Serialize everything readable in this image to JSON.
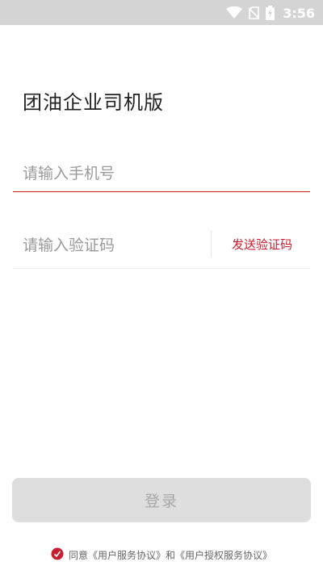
{
  "status_bar": {
    "time": "3:56",
    "icons": [
      "wifi-icon",
      "no-sim-icon",
      "battery-charging-icon"
    ]
  },
  "app": {
    "title": "团油企业司机版"
  },
  "form": {
    "phone_placeholder": "请输入手机号",
    "code_placeholder": "请输入验证码",
    "send_code_label": "发送验证码",
    "login_label": "登录"
  },
  "agreement": {
    "text": "同意《用户服务协议》和《用户授权服务协议》",
    "icon": "checkbox-circle-icon"
  },
  "colors": {
    "accent": "#c81e2f",
    "status_bar": "#d4d4d4",
    "button_disabled": "#dedede"
  }
}
